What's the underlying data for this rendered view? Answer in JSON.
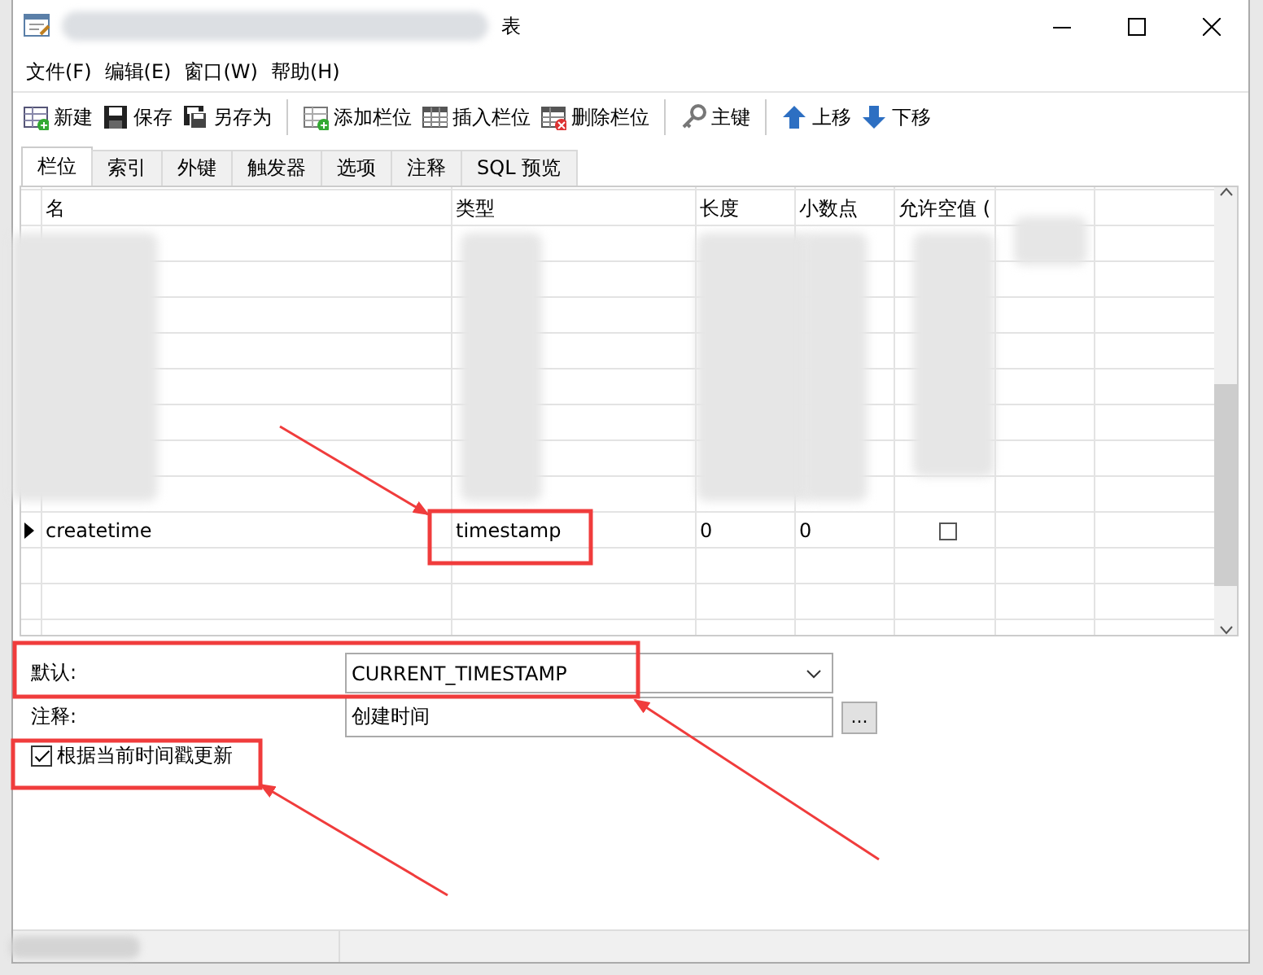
{
  "window": {
    "title": "表"
  },
  "menu": [
    "文件(F)",
    "编辑(E)",
    "窗口(W)",
    "帮助(H)"
  ],
  "toolbar_groups": [
    [
      {
        "kind": "new",
        "label": "新建"
      },
      {
        "kind": "save",
        "label": "保存"
      },
      {
        "kind": "save_as",
        "label": "另存为"
      }
    ],
    [
      {
        "kind": "add_column",
        "label": "添加栏位"
      },
      {
        "kind": "insert_column",
        "label": "插入栏位"
      },
      {
        "kind": "delete_column",
        "label": "删除栏位"
      }
    ],
    [
      {
        "kind": "key",
        "label": "主键"
      }
    ],
    [
      {
        "kind": "up",
        "label": "上移"
      },
      {
        "kind": "down",
        "label": "下移"
      }
    ]
  ],
  "tabs": [
    {
      "label": "栏位",
      "selected": true
    },
    {
      "label": "索引",
      "selected": false
    },
    {
      "label": "外键",
      "selected": false
    },
    {
      "label": "触发器",
      "selected": false
    },
    {
      "label": "选项",
      "selected": false
    },
    {
      "label": "注释",
      "selected": false
    },
    {
      "label": "SQL 预览",
      "selected": false
    }
  ],
  "grid": {
    "columns": [
      "名",
      "类型",
      "长度",
      "小数点",
      "允许空值 ("
    ],
    "rows": [
      {
        "name": "createtime",
        "type": "timestamp",
        "length": "0",
        "decimals": "0",
        "nullable": false,
        "current": true,
        "highlighted": true
      }
    ]
  },
  "properties": {
    "default": {
      "label": "默认:",
      "value": "CURRENT_TIMESTAMP",
      "highlighted": true
    },
    "comment": {
      "label": "注释:",
      "value": "创建时间",
      "button": "..."
    },
    "on_update": {
      "label": "根据当前时间戳更新",
      "checked": true,
      "highlighted": true
    }
  }
}
